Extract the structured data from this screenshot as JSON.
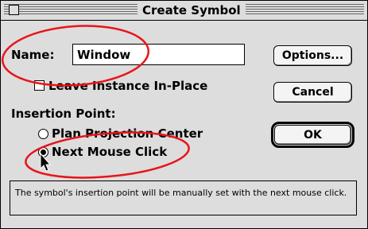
{
  "window": {
    "title": "Create Symbol"
  },
  "name": {
    "label": "Name:",
    "value": "Window"
  },
  "buttons": {
    "options": "Options...",
    "cancel": "Cancel",
    "ok": "OK"
  },
  "leave_instance": {
    "label": "Leave Instance In-Place",
    "checked": false
  },
  "insertion_point": {
    "heading": "Insertion Point:",
    "options": [
      {
        "label": "Plan Projection Center",
        "selected": false
      },
      {
        "label": "Next Mouse Click",
        "selected": true
      }
    ]
  },
  "description": "The symbol's insertion point will be manually set with the next mouse click.",
  "annotation_color": "#e8141c"
}
